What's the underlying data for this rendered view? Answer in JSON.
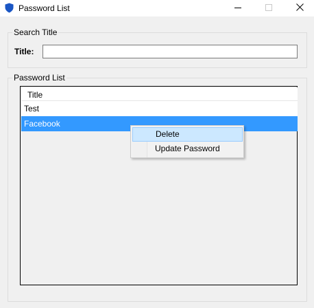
{
  "window": {
    "title": "Password List"
  },
  "caption_buttons": {
    "minimize": "minimize-icon",
    "maximize": "maximize-icon",
    "close": "close-icon"
  },
  "search_group": {
    "legend": "Search Title",
    "title_label": "Title:",
    "title_value": "",
    "title_placeholder": ""
  },
  "list_group": {
    "legend": "Password List",
    "columns": [
      "Title"
    ],
    "rows": [
      "Test",
      "Facebook"
    ],
    "selected_row": "Facebook"
  },
  "context_menu": {
    "items": [
      "Delete",
      "Update Password"
    ],
    "highlighted": "Delete"
  },
  "colors": {
    "selection": "#3399ff",
    "menu_highlight": "#cce8ff",
    "app_icon": "#1a56c4"
  }
}
